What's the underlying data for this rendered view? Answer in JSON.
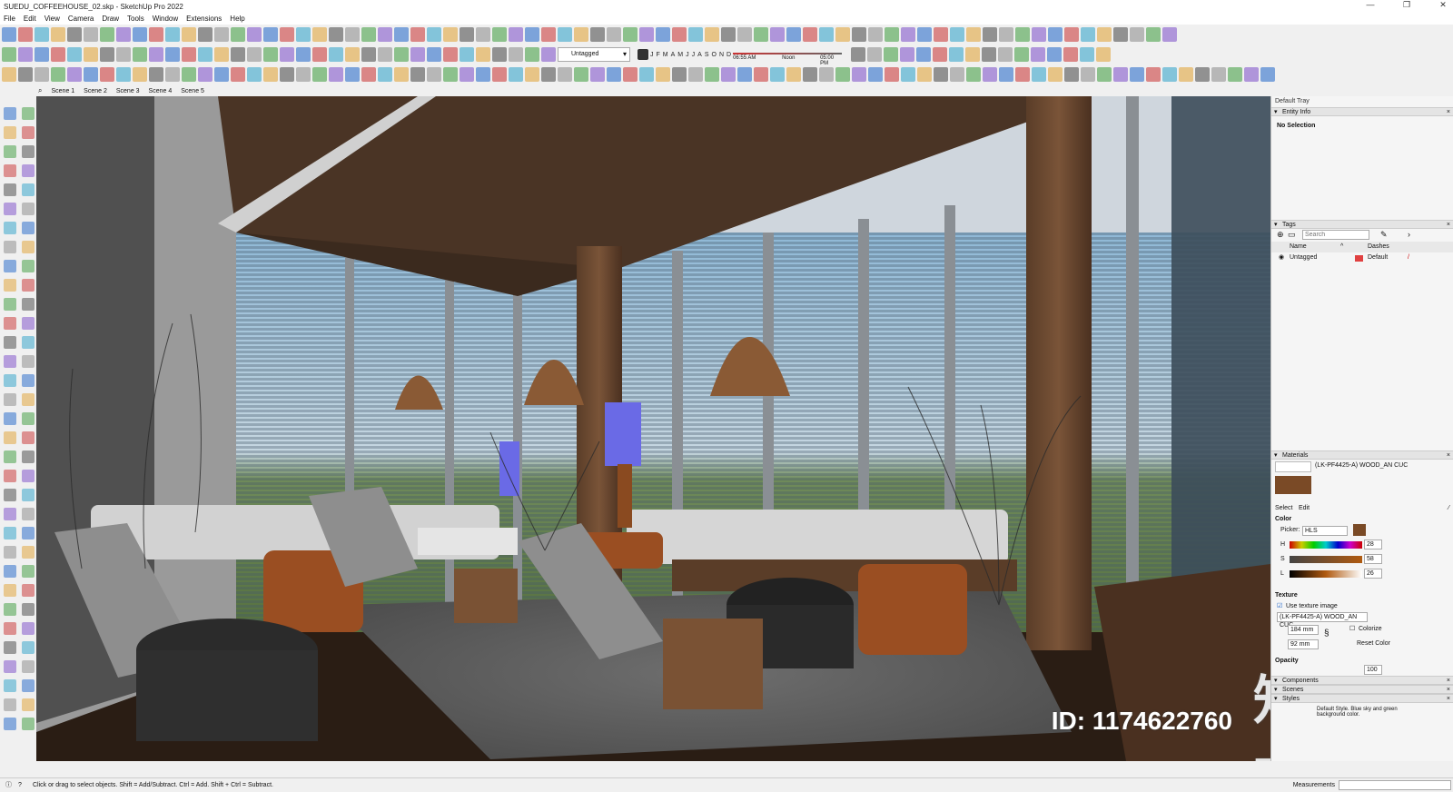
{
  "window": {
    "title": "SUEDU_COFFEEHOUSE_02.skp - SketchUp Pro 2022",
    "controls": [
      "—",
      "❐",
      "✕"
    ]
  },
  "menu": [
    "File",
    "Edit",
    "View",
    "Camera",
    "Draw",
    "Tools",
    "Window",
    "Extensions",
    "Help"
  ],
  "toolbar": {
    "tag_dropdown": "Untagged",
    "months": [
      "J",
      "F",
      "M",
      "A",
      "M",
      "J",
      "J",
      "A",
      "S",
      "O",
      "N",
      "D"
    ],
    "time_start": "06:55 AM",
    "time_mid": "Noon",
    "time_end": "05:00 PM"
  },
  "scenes": [
    "Scene 1",
    "Scene 2",
    "Scene 3",
    "Scene 4",
    "Scene 5"
  ],
  "tray": {
    "title": "Default Tray",
    "entity_info": {
      "header": "Entity Info",
      "selection": "No Selection"
    },
    "tags": {
      "header": "Tags",
      "search_placeholder": "Search",
      "col_name": "Name",
      "col_dashes": "Dashes",
      "row_name": "Untagged",
      "row_dashes": "Default"
    },
    "materials": {
      "header": "Materials",
      "name": "(LK-PF4425-A) WOOD_AN CUC",
      "select_tab": "Select",
      "edit_tab": "Edit",
      "color_label": "Color",
      "picker_label": "Picker:",
      "picker_value": "HLS",
      "h_label": "H",
      "h_value": "28",
      "s_label": "S",
      "s_value": "58",
      "l_label": "L",
      "l_value": "26",
      "texture_label": "Texture",
      "use_texture": "Use texture image",
      "texture_file": "(LK-PF4425-A) WOOD_AN CUC",
      "width": "184 mm",
      "height": "92 mm",
      "colorize": "Colorize",
      "reset_color": "Reset Color",
      "opacity_label": "Opacity",
      "opacity_value": "100",
      "swatch_color": "#7a4a26"
    },
    "components_header": "Components",
    "scenes_header": "Scenes",
    "styles_header": "Styles",
    "styles_desc": "Default Style. Blue sky and green background color."
  },
  "status": {
    "hint": "Click or drag to select objects. Shift = Add/Subtract. Ctrl = Add. Shift + Ctrl = Subtract.",
    "measurements": "Measurements"
  },
  "watermark": {
    "id": "ID: 1174622760",
    "logo": "知末"
  },
  "colors": {
    "accent": "#1e64c8",
    "tag_red": "#e04040",
    "ceiling": "#3b2a1e",
    "floor": "#2a1d14"
  }
}
